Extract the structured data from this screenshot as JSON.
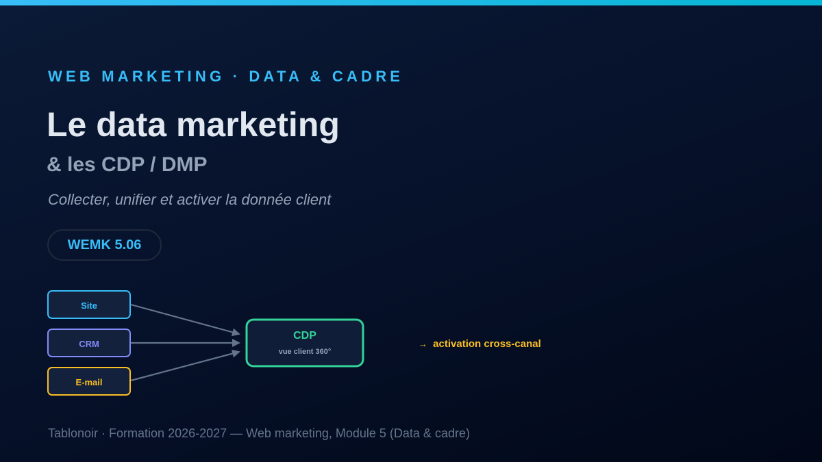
{
  "slide": {
    "kicker": "WEB MARKETING · DATA & CADRE",
    "title": "Le data marketing",
    "subtitle": "& les CDP / DMP",
    "tagline": "Collecter, unifier et activer la donnée client",
    "code": "WEMK 5.06",
    "footer": "Tablonoir · Formation 2026-2027 — Web marketing, Module 5 (Data & cadre)"
  },
  "diagram": {
    "sources": [
      {
        "label": "Site",
        "color": "#38bdf8"
      },
      {
        "label": "CRM",
        "color": "#818cf8"
      },
      {
        "label": "E-mail",
        "color": "#fbbf24"
      }
    ],
    "target": {
      "label": "CDP",
      "sublabel": "vue client 360°",
      "color": "#34d399"
    },
    "output": {
      "arrow": "→",
      "label": "activation cross-canal",
      "color": "#fbbf24"
    },
    "connector_color": "#64748b"
  }
}
